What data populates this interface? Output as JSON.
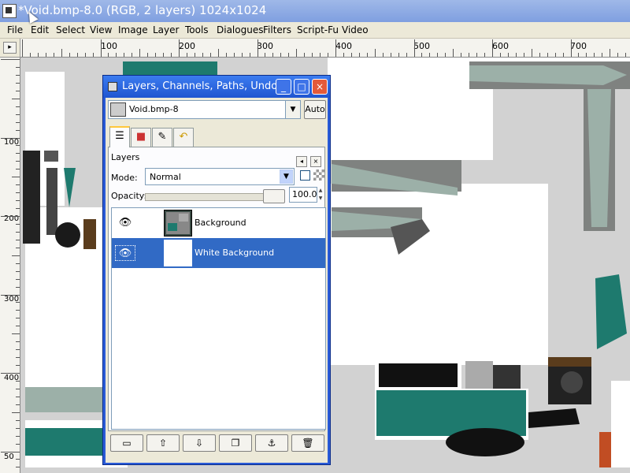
{
  "window": {
    "title": "*Void.bmp-8.0 (RGB, 2 layers) 1024x1024"
  },
  "menubar": {
    "items": [
      "File",
      "Edit",
      "Select",
      "View",
      "Image",
      "Layer",
      "Tools",
      "Dialogues",
      "Filters",
      "Script-Fu",
      "Video"
    ]
  },
  "ruler": {
    "corner_button": "▸",
    "horizontal_labels": [
      "100",
      "200",
      "300",
      "400",
      "500",
      "600",
      "700"
    ],
    "vertical_labels": [
      "100",
      "200",
      "300",
      "400",
      "50"
    ]
  },
  "dialog": {
    "title": "Layers, Channels, Paths, Undo",
    "image_selector": "Void.bmp-8",
    "auto_button": "Auto",
    "tabs": [
      "layers-tab-icon",
      "channels-tab-icon",
      "paths-tab-icon",
      "undo-tab-icon"
    ],
    "panel_title": "Layers",
    "mode_label": "Mode:",
    "mode_value": "Normal",
    "opacity_label": "Opacity:",
    "opacity_value": "100.0",
    "layers": [
      {
        "name": "Background",
        "visible": true,
        "selected": false
      },
      {
        "name": "White Background",
        "visible": true,
        "selected": true
      }
    ],
    "bottom_buttons": [
      "new-layer-icon",
      "raise-layer-icon",
      "lower-layer-icon",
      "duplicate-layer-icon",
      "anchor-layer-icon",
      "delete-layer-icon"
    ]
  },
  "colors": {
    "accent_teal": "#1e7a6e",
    "selection_blue": "#316ac5",
    "pale_green": "#9cb0a8"
  }
}
